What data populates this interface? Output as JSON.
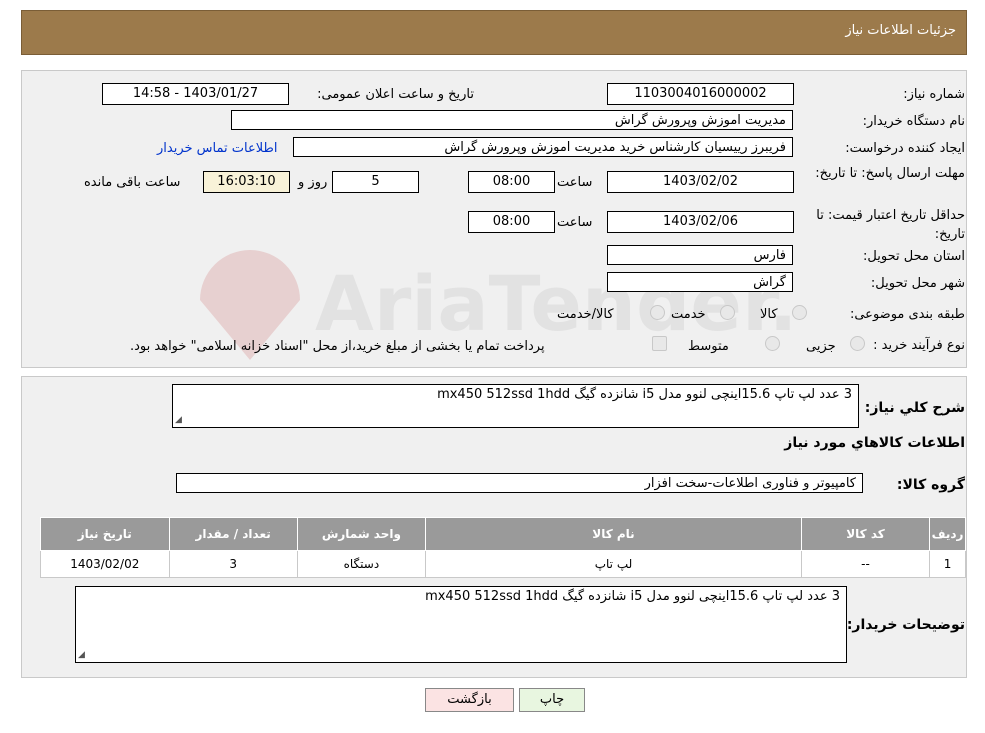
{
  "header": {
    "title": "جزئیات اطلاعات نیاز"
  },
  "fields": {
    "need_number_label": "شماره نیاز:",
    "need_number": "1103004016000002",
    "announce_label": "تاریخ و ساعت اعلان عمومی:",
    "announce_value": "1403/01/27 - 14:58",
    "buyer_org_label": "نام دستگاه خریدار:",
    "buyer_org": "مدیریت اموزش وپرورش گراش",
    "creator_label": "ایجاد کننده درخواست:",
    "creator": "فریبرز رییسیان کارشناس خرید مدیریت اموزش وپرورش گراش",
    "contact_link": "اطلاعات تماس خریدار",
    "deadline_label": "مهلت ارسال پاسخ: تا تاریخ:",
    "deadline_date": "1403/02/02",
    "time_label": "ساعت",
    "deadline_time": "08:00",
    "days": "5",
    "days_label": "روز و",
    "remaining_time": "16:03:10",
    "remaining_label": "ساعت باقی مانده",
    "validity_label": "حداقل تاریخ اعتبار قیمت: تا تاریخ:",
    "validity_date": "1403/02/06",
    "validity_time": "08:00",
    "province_label": "استان محل تحویل:",
    "province": "فارس",
    "city_label": "شهر محل تحویل:",
    "city": "گراش",
    "category_label": "طبقه بندی موضوعی:",
    "category_options": [
      "کالا",
      "خدمت",
      "کالا/خدمت"
    ],
    "process_label": "نوع فرآیند خرید :",
    "process_options": [
      "جزیی",
      "متوسط"
    ],
    "process_note": "پرداخت تمام یا بخشی از مبلغ خرید،از محل \"اسناد خزانه اسلامی\" خواهد بود."
  },
  "description": {
    "label": "شرح کلي نياز:",
    "text": "3 عدد لپ تاپ 15.6اینچی لنوو مدل i5  شانزده گیگ mx450  512ssd    1hdd"
  },
  "goods_title": "اطلاعات کالاهاي مورد نياز",
  "goods_group": {
    "label": "گروه کالا:",
    "value": "کامپیوتر و فناوری اطلاعات-سخت افزار"
  },
  "table": {
    "headers": [
      "رديف",
      "کد کالا",
      "نام کالا",
      "واحد شمارش",
      "تعداد / مقدار",
      "تاريخ نياز"
    ],
    "rows": [
      [
        "1",
        "--",
        "لپ تاپ",
        "دستگاه",
        "3",
        "1403/02/02"
      ]
    ]
  },
  "buyer_notes": {
    "label": "توضیحات خریدار:",
    "text": "3 عدد لپ تاپ 15.6اینچی لنوو مدل i5  شانزده گیگ mx450  512ssd    1hdd"
  },
  "buttons": {
    "print": "چاپ",
    "back": "بازگشت"
  },
  "watermark": "AriaTender.neT"
}
